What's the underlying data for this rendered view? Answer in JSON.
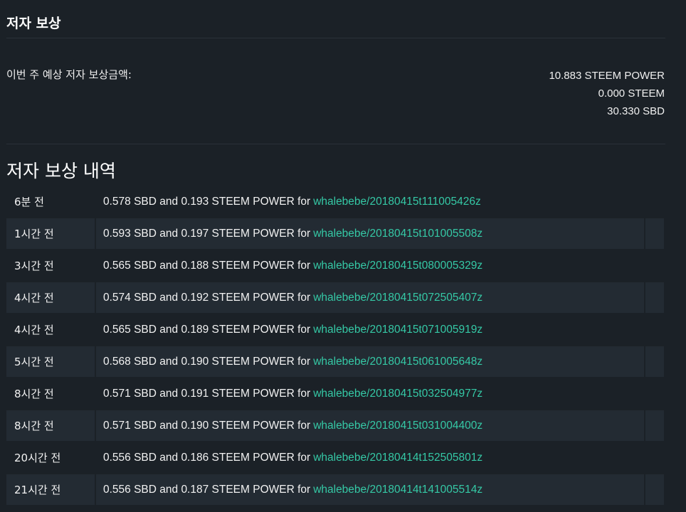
{
  "section_title": "저자 보상",
  "estimate": {
    "label": "이번 주 예상 저자 보상금액:",
    "steem_power": "10.883 STEEM POWER",
    "steem": "0.000 STEEM",
    "sbd": "30.330 SBD"
  },
  "history_title": "저자 보상 내역",
  "rows": [
    {
      "time": "6분 전",
      "desc": "0.578 SBD and 0.193 STEEM POWER for",
      "link": "whalebebe/20180415t111005426z"
    },
    {
      "time": "1시간 전",
      "desc": "0.593 SBD and 0.197 STEEM POWER for",
      "link": "whalebebe/20180415t101005508z"
    },
    {
      "time": "3시간 전",
      "desc": "0.565 SBD and 0.188 STEEM POWER for",
      "link": "whalebebe/20180415t080005329z"
    },
    {
      "time": "4시간 전",
      "desc": "0.574 SBD and 0.192 STEEM POWER for",
      "link": "whalebebe/20180415t072505407z"
    },
    {
      "time": "4시간 전",
      "desc": "0.565 SBD and 0.189 STEEM POWER for",
      "link": "whalebebe/20180415t071005919z"
    },
    {
      "time": "5시간 전",
      "desc": "0.568 SBD and 0.190 STEEM POWER for",
      "link": "whalebebe/20180415t061005648z"
    },
    {
      "time": "8시간 전",
      "desc": "0.571 SBD and 0.191 STEEM POWER for",
      "link": "whalebebe/20180415t032504977z"
    },
    {
      "time": "8시간 전",
      "desc": "0.571 SBD and 0.190 STEEM POWER for",
      "link": "whalebebe/20180415t031004400z"
    },
    {
      "time": "20시간 전",
      "desc": "0.556 SBD and 0.186 STEEM POWER for",
      "link": "whalebebe/20180414t152505801z"
    },
    {
      "time": "21시간 전",
      "desc": "0.556 SBD and 0.187 STEEM POWER for",
      "link": "whalebebe/20180414t141005514z"
    }
  ],
  "colors": {
    "background": "#1b2127",
    "stripe": "#232b33",
    "link": "#35c9a6",
    "text": "#f2f2f2"
  }
}
